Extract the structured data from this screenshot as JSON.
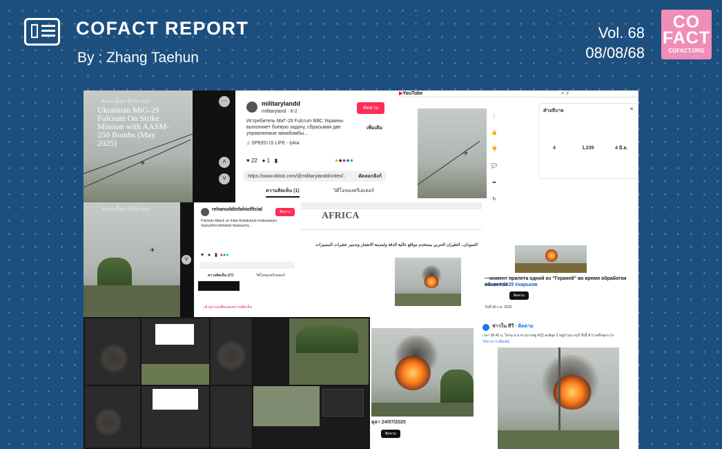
{
  "header": {
    "title": "COFACT REPORT",
    "byline": "By : Zhang Taehun",
    "volume": "Vol. 68",
    "date": "08/08/68"
  },
  "logo": {
    "line1": "CO",
    "line2": "FACT",
    "site": "COFACT.ORG",
    "color": "#f08db8"
  },
  "colors": {
    "background": "#1d4f7e",
    "tiktok_red": "#fe2c55",
    "fb_blue": "#1877f2"
  },
  "collage": {
    "video1": {
      "search_text": "ค้นหาเนื้อหาที่เกี่ยวข้อง",
      "caption": "Ukrainian MiG-29 Fulcrum On Strike Mission with AASM-250 Bombs (May 2025)"
    },
    "tiktok_main": {
      "username": "militarylandd",
      "handle": "militaryland · 6-2",
      "follow": "ติดตาม",
      "description": "Истребитель МиГ-29 Fulcrum ВВС Украины выполняет боевую задачу, сбрасывая две управляемые авиабомбы...",
      "more": "เพิ่มเติม",
      "sound": "♫ SPEED IS LIFE - lykia",
      "likes": "22",
      "comments": "1",
      "url": "https://www.tiktok.com/@militarylandd/video/7511037...",
      "copy_link": "คัดลอกลิงก์",
      "tab_comments": "ความคิดเห็น (1)",
      "tab_creator": "วิดีโอของครีเอเตอร์"
    },
    "youtube": {
      "brand": "YouTube",
      "desc_title": "คำอธิบาย",
      "views": "4",
      "likes": "1,239",
      "date": "4 มิ.ย."
    },
    "video2": {
      "search_text": "ค้นหาเนื้อหาที่เกี่ยวข้อง"
    },
    "tiktok_small": {
      "username": "rehanuddinfahiofficial",
      "follow": "ติดตาม",
      "description": "Pakistan Attack on India #balakudub #ukkastarjes #pakanforcebdabad #paksarmy...",
      "tab_comments": "ความคิดเห็น (27)",
      "tab_creator": "วิดีโอของครีเอเตอร์",
      "login_prompt": "เข้าสู่ระบบเพื่อแสดงความคิดเห็น"
    },
    "africa": {
      "brand": "AFRICA",
      "headline": "السودان.. الطيران الحربي يستخدم مواقع عالية الدقة ولمدينة الانفجار وتدمير عشرات المسيرات"
    },
    "russian_post": {
      "caption": "—момент прилета одной из \"Гераней\" во время обработки объектов",
      "hashtags": "#хата # 2025 #харьков",
      "follow": "ติดตาม",
      "date": "วันที่ 30 ก.ค. 2025"
    },
    "fb_small": {
      "date": "ตุลา 24/07/2025",
      "follow": "ติดตาม"
    },
    "fb_right": {
      "page_name": "ข่าวใน ทีวี",
      "follow": "ติดตาม",
      "caption": "เวลา 05.40 น. โดรน ยาง ทางบางหมู่ 4(2) ละติจูด 2 หมู่บ้านบางบุรี ทั้งนี้ ตำรวจตั้งจุดระวัง",
      "more": "ได้ทางการเพิ่มเติม"
    }
  }
}
